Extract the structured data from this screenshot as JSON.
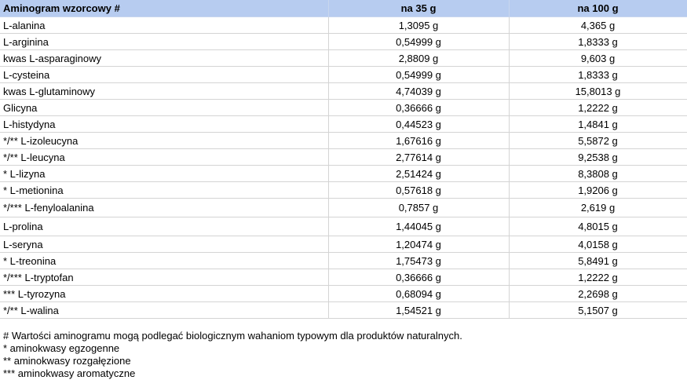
{
  "table": {
    "headers": [
      "Aminogram wzorcowy #",
      "na 35 g",
      "na 100 g"
    ],
    "rows": [
      [
        "L-alanina",
        "1,3095 g",
        "4,365 g"
      ],
      [
        "L-arginina",
        "0,54999 g",
        "1,8333 g"
      ],
      [
        "kwas L-asparaginowy",
        "2,8809 g",
        "9,603 g"
      ],
      [
        "L-cysteina",
        "0,54999 g",
        "1,8333 g"
      ],
      [
        "kwas L-glutaminowy",
        "4,74039 g",
        "15,8013 g"
      ],
      [
        "Glicyna",
        "0,36666 g",
        "1,2222 g"
      ],
      [
        "L-histydyna",
        "0,44523 g",
        "1,4841 g"
      ],
      [
        "*/** L-izoleucyna",
        "1,67616 g",
        "5,5872 g"
      ],
      [
        "*/** L-leucyna",
        "2,77614 g",
        "9,2538 g"
      ],
      [
        "* L-lizyna",
        "2,51424 g",
        "8,3808 g"
      ],
      [
        "* L-metionina",
        "0,57618 g",
        "1,9206 g"
      ],
      [
        "*/*** L-fenyloalanina",
        "0,7857 g",
        "2,619 g"
      ],
      [
        "L-prolina",
        "1,44045 g",
        "4,8015 g"
      ],
      [
        "L-seryna",
        "1,20474 g",
        "4,0158 g"
      ],
      [
        "* L-treonina",
        "1,75473 g",
        "5,8491 g"
      ],
      [
        "*/*** L-tryptofan",
        "0,36666 g",
        "1,2222 g"
      ],
      [
        "*** L-tyrozyna",
        "0,68094 g",
        "2,2698 g"
      ],
      [
        "*/** L-walina",
        "1,54521 g",
        "5,1507 g"
      ]
    ]
  },
  "notes": [
    "# Wartości aminogramu mogą podlegać biologicznym wahaniom typowym dla produktów naturalnych.",
    "* aminokwasy egzogenne",
    "** aminokwasy rozgałęzione",
    "*** aminokwasy aromatyczne"
  ],
  "colors": {
    "header_bg": "#b7ccf0",
    "grid": "#d4d4d4"
  }
}
